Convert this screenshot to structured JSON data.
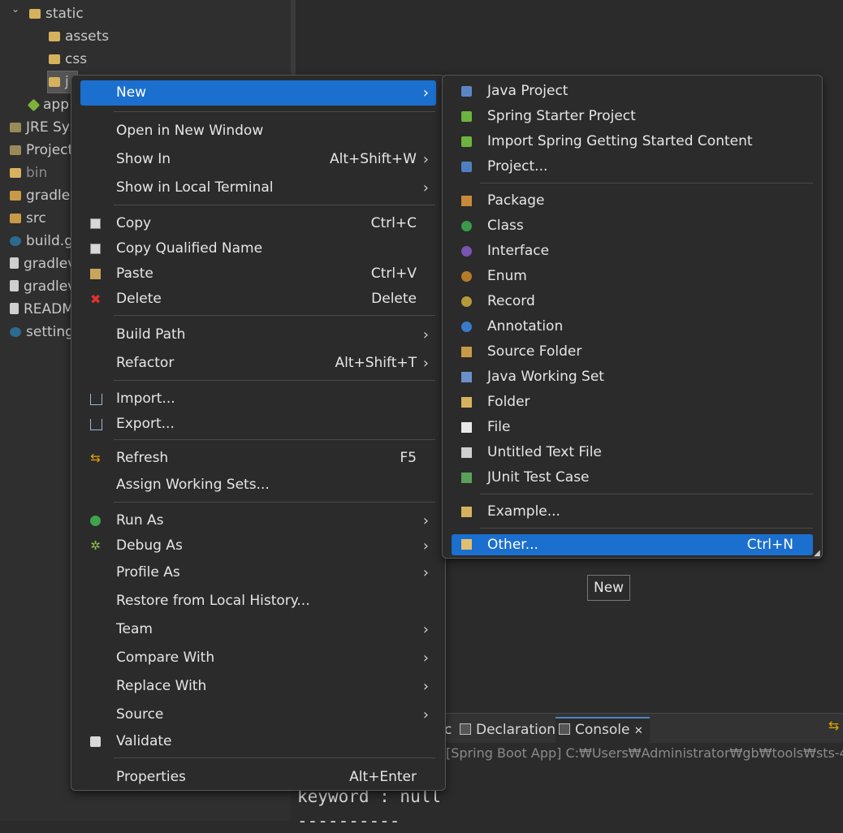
{
  "explorer": {
    "items": [
      {
        "label": "static",
        "icon": "folder-open-icon",
        "indent": 36,
        "twisty": "⌄"
      },
      {
        "label": "assets",
        "icon": "folder-icon",
        "indent": 60
      },
      {
        "label": "css",
        "icon": "folder-icon",
        "indent": 60
      },
      {
        "label": "j",
        "icon": "folder-icon",
        "indent": 60
      },
      {
        "label": "app",
        "icon": "app-properties-icon",
        "indent": 36
      },
      {
        "label": "JRE Sys",
        "icon": "library-icon",
        "indent": 12
      },
      {
        "label": "Project",
        "icon": "library-icon",
        "indent": 12
      },
      {
        "label": "bin",
        "icon": "folder-icon",
        "indent": 12
      },
      {
        "label": "gradle",
        "icon": "folder-icon",
        "indent": 12
      },
      {
        "label": "src",
        "icon": "source-folder-icon",
        "indent": 12
      },
      {
        "label": "build.g",
        "icon": "gradle-file-icon",
        "indent": 12
      },
      {
        "label": "gradlev",
        "icon": "file-icon",
        "indent": 12
      },
      {
        "label": "gradlev",
        "icon": "file-icon",
        "indent": 12
      },
      {
        "label": "READM",
        "icon": "markdown-file-icon",
        "indent": 12
      },
      {
        "label": "setting",
        "icon": "gradle-file-icon",
        "indent": 12
      }
    ]
  },
  "context_menu": {
    "items": [
      {
        "label": "New",
        "submenu": true,
        "highlighted": true
      },
      {
        "label": "Open in New Window"
      },
      {
        "label": "Show In",
        "shortcut": "Alt+Shift+W",
        "submenu": true
      },
      {
        "label": "Show in Local Terminal",
        "submenu": true
      },
      {
        "label": "Copy",
        "shortcut": "Ctrl+C",
        "icon": "copy-icon"
      },
      {
        "label": "Copy Qualified Name",
        "icon": "copy-qualified-name-icon"
      },
      {
        "label": "Paste",
        "shortcut": "Ctrl+V",
        "icon": "paste-icon"
      },
      {
        "label": "Delete",
        "shortcut": "Delete",
        "icon": "delete-icon"
      },
      {
        "label": "Build Path",
        "submenu": true
      },
      {
        "label": "Refactor",
        "shortcut": "Alt+Shift+T",
        "submenu": true
      },
      {
        "label": "Import...",
        "icon": "import-icon"
      },
      {
        "label": "Export...",
        "icon": "export-icon"
      },
      {
        "label": "Refresh",
        "shortcut": "F5",
        "icon": "refresh-icon"
      },
      {
        "label": "Assign Working Sets..."
      },
      {
        "label": "Run As",
        "submenu": true,
        "icon": "run-icon"
      },
      {
        "label": "Debug As",
        "submenu": true,
        "icon": "debug-icon"
      },
      {
        "label": "Profile As",
        "submenu": true
      },
      {
        "label": "Restore from Local History..."
      },
      {
        "label": "Team",
        "submenu": true
      },
      {
        "label": "Compare With",
        "submenu": true
      },
      {
        "label": "Replace With",
        "submenu": true
      },
      {
        "label": "Source",
        "submenu": true
      },
      {
        "label": "Validate",
        "icon": "checkbox-checked-icon"
      },
      {
        "label": "Properties",
        "shortcut": "Alt+Enter"
      }
    ]
  },
  "new_submenu": {
    "items": [
      {
        "label": "Java Project",
        "icon": "java-project-icon"
      },
      {
        "label": "Spring Starter Project",
        "icon": "spring-starter-icon"
      },
      {
        "label": "Import Spring Getting Started Content",
        "icon": "spring-import-icon"
      },
      {
        "label": "Project...",
        "icon": "project-icon"
      },
      {
        "label": "Package",
        "icon": "package-icon"
      },
      {
        "label": "Class",
        "icon": "class-icon"
      },
      {
        "label": "Interface",
        "icon": "interface-icon"
      },
      {
        "label": "Enum",
        "icon": "enum-icon"
      },
      {
        "label": "Record",
        "icon": "record-icon"
      },
      {
        "label": "Annotation",
        "icon": "annotation-icon"
      },
      {
        "label": "Source Folder",
        "icon": "source-folder-icon"
      },
      {
        "label": "Java Working Set",
        "icon": "working-set-icon"
      },
      {
        "label": "Folder",
        "icon": "folder-icon"
      },
      {
        "label": "File",
        "icon": "file-icon"
      },
      {
        "label": "Untitled Text File",
        "icon": "text-file-icon"
      },
      {
        "label": "JUnit Test Case",
        "icon": "junit-icon"
      },
      {
        "label": "Example...",
        "icon": "example-icon"
      },
      {
        "label": "Other...",
        "shortcut": "Ctrl+N",
        "icon": "other-wizard-icon",
        "highlighted": true
      }
    ]
  },
  "tooltip": "New",
  "bottom_tabs": [
    {
      "label": "c",
      "icon": "",
      "active": false
    },
    {
      "label": "Declaration",
      "icon": "declaration-icon",
      "active": false
    },
    {
      "label": "Console",
      "icon": "console-icon",
      "active": true,
      "close": "✕"
    }
  ],
  "console": {
    "title": "[Spring Boot App] C:₩Users₩Administrator₩gb₩tools₩sts-4",
    "lines": [
      "keyword : null",
      "----------"
    ]
  },
  "icons": {
    "arrow": "›",
    "refresh": "⇆",
    "debug": "✲",
    "delete": "✖"
  },
  "colors": {
    "highlight": "#1b6fce",
    "background": "#2b2b2b"
  }
}
